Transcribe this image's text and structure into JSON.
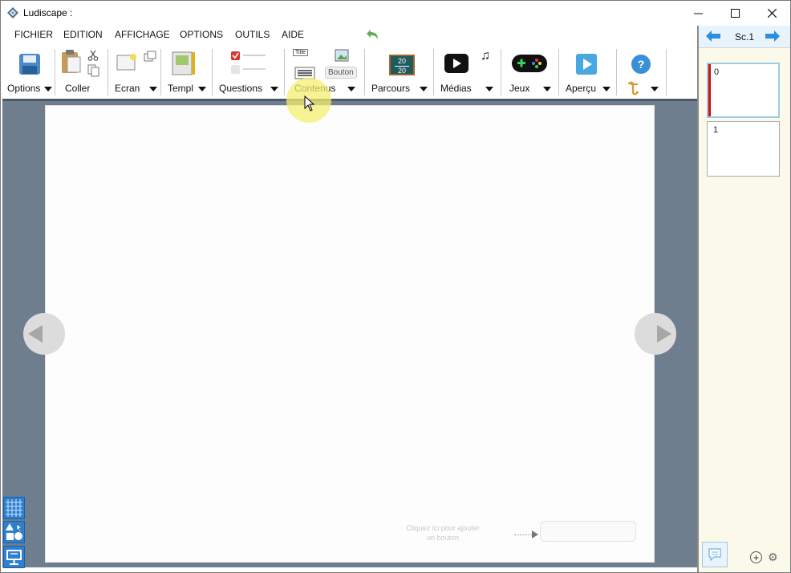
{
  "window": {
    "title": "Ludiscape :"
  },
  "menu": {
    "items": [
      "FICHIER",
      "EDITION",
      "AFFICHAGE",
      "OPTIONS",
      "OUTILS",
      "AIDE"
    ]
  },
  "toolbar": {
    "options_label": "Options",
    "coller_label": "Coller",
    "ecran_label": "Ecran",
    "templ_label": "Templ",
    "questions_label": "Questions",
    "contenus_label": "Contenus",
    "title_tag": "Title",
    "bouton_tag": "Bouton",
    "parcours_label": "Parcours",
    "parcours_icon_top": "20",
    "parcours_icon_bottom": "20",
    "medias_label": "Médias",
    "jeux_label": "Jeux",
    "apercu_label": "Aperçu"
  },
  "canvas": {
    "hint_text": "Cliquez ici pour ajouter un bouton"
  },
  "scenes": {
    "current": "Sc.1",
    "slides": [
      "0",
      "1"
    ]
  },
  "colors": {
    "accent_blue": "#2d7fd0",
    "workspace_bg": "#6f7e8e",
    "panel_bg": "#fbf9e9",
    "active_marker": "#cc1010"
  },
  "icons": {
    "app": "ludiscape-logo-icon",
    "undo": "undo-arrow-icon",
    "save": "floppy-disk-icon",
    "grid": "grid-icon",
    "shapes": "shapes-icon",
    "presentation": "presentation-icon"
  }
}
